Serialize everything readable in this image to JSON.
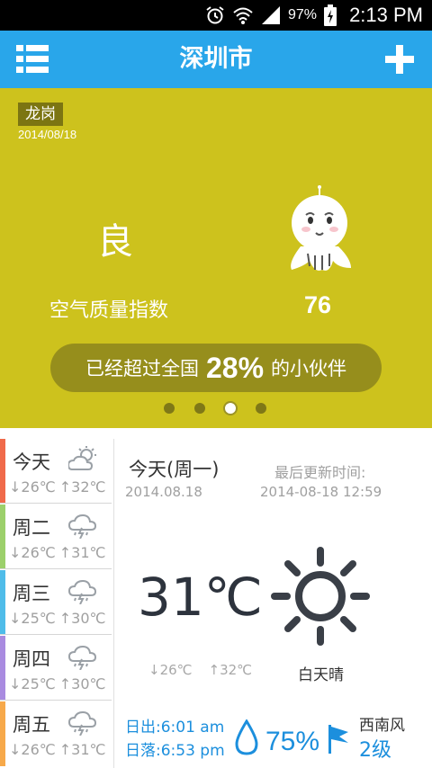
{
  "status_bar": {
    "battery": "97%",
    "time": "2:13 PM",
    "icons": [
      "alarm-icon",
      "wifi-icon",
      "signal-icon",
      "battery-charging-icon"
    ]
  },
  "app_bar": {
    "title": "深圳市",
    "menu_icon": "list-menu-icon",
    "add_icon": "plus-icon",
    "color": "#29a6ea"
  },
  "air_quality": {
    "district": "龙岗",
    "date": "2014/08/18",
    "level": "良",
    "label": "空气质量指数",
    "value": "76",
    "ranking_prefix": "已经超过全国",
    "ranking_percent": "28%",
    "ranking_suffix": "的小伙伴",
    "pager": {
      "count": 4,
      "active_index": 2
    },
    "color": "#cdc21d"
  },
  "forecast": [
    {
      "day": "今天",
      "low": "↓26℃",
      "high": "↑32℃",
      "icon": "partly-cloudy-icon",
      "color": "#f06a4a"
    },
    {
      "day": "周二",
      "low": "↓26℃",
      "high": "↑31℃",
      "icon": "thunderstorm-icon",
      "color": "#9cd06b"
    },
    {
      "day": "周三",
      "low": "↓25℃",
      "high": "↑30℃",
      "icon": "thunderstorm-icon",
      "color": "#4fbce9"
    },
    {
      "day": "周四",
      "low": "↓25℃",
      "high": "↑30℃",
      "icon": "thunderstorm-icon",
      "color": "#a98be0"
    },
    {
      "day": "周五",
      "low": "↓26℃",
      "high": "↑31℃",
      "icon": "thunderstorm-icon",
      "color": "#f7a94a"
    }
  ],
  "detail": {
    "day": "今天(周一)",
    "date": "2014.08.18",
    "updated_label": "最后更新时间:",
    "updated_time": "2014-08-18 12:59",
    "temperature": "31℃",
    "low": "↓26℃",
    "high": "↑32℃",
    "condition": "白天晴",
    "condition_icon": "sun-icon",
    "sunrise": "日出:6:01 am",
    "sunset": "日落:6:53 pm",
    "humidity": "75%",
    "wind_direction": "西南风",
    "wind_level": "2级"
  }
}
